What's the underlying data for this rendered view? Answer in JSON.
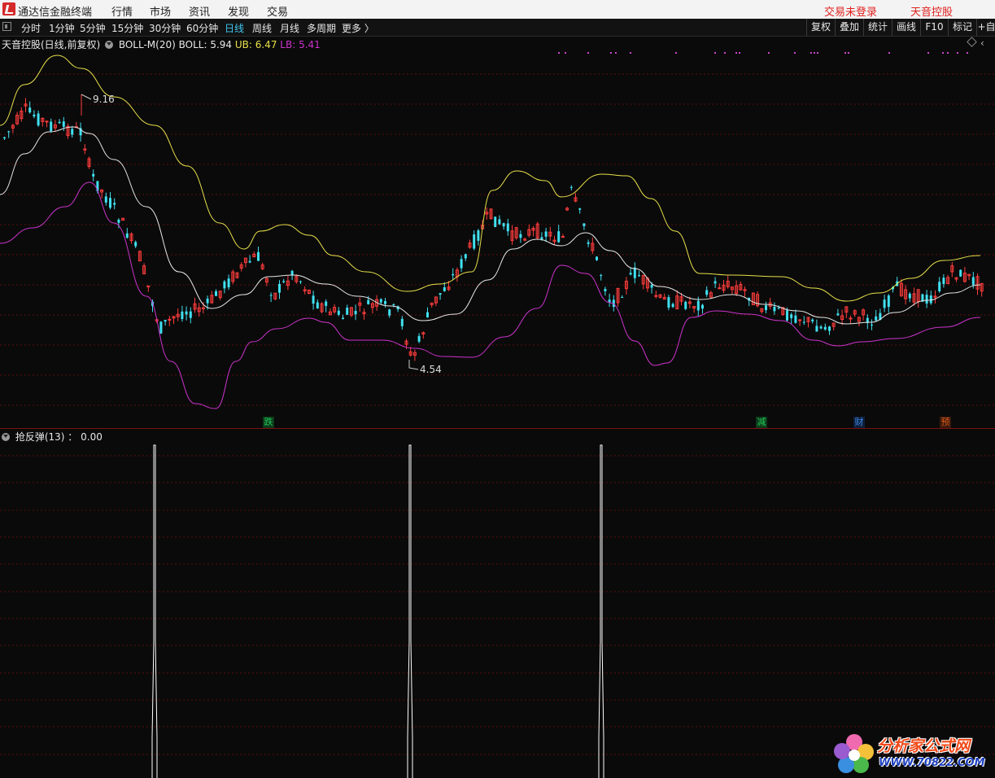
{
  "menubar": {
    "app_name": "通达信金融终端",
    "items": [
      "行情",
      "市场",
      "资讯",
      "发现",
      "交易"
    ],
    "right_items": [
      "交易未登录",
      "天音控股"
    ]
  },
  "toolbar": {
    "periods": [
      "分时",
      "1分钟",
      "5分钟",
      "15分钟",
      "30分钟",
      "60分钟",
      "日线",
      "周线",
      "月线",
      "多周期",
      "更多 〉"
    ],
    "active_period": "日线",
    "right_buttons": [
      "复权",
      "叠加",
      "统计",
      "画线",
      "F10",
      "标记",
      "+自"
    ]
  },
  "main_chart": {
    "stock_title": "天音控股(日线,前复权)",
    "indicator": "BOLL-M(20)",
    "boll_label": "BOLL: 5.94",
    "ub_label": "UB: 6.47",
    "lb_label": "LB: 5.41",
    "high_label": "9.16",
    "low_label": "4.54",
    "colors": {
      "mid": "#e6e6e6",
      "ub": "#e8e04a",
      "lb": "#cc33cc",
      "up": "#ff3c3c",
      "down": "#40e0f0",
      "grid": "#5a0d0d"
    }
  },
  "event_markers": [
    {
      "text": "跌",
      "color": "#22c85a"
    },
    {
      "text": "减",
      "color": "#22c85a"
    },
    {
      "text": "财",
      "color": "#3d86e6"
    },
    {
      "text": "预",
      "color": "#e05a1a"
    }
  ],
  "sub_chart": {
    "indicator": "抢反弹(13)",
    "value": "0.00"
  },
  "watermark": {
    "line1": "分析家公式网",
    "line2": "WWW.70822.COM"
  }
}
